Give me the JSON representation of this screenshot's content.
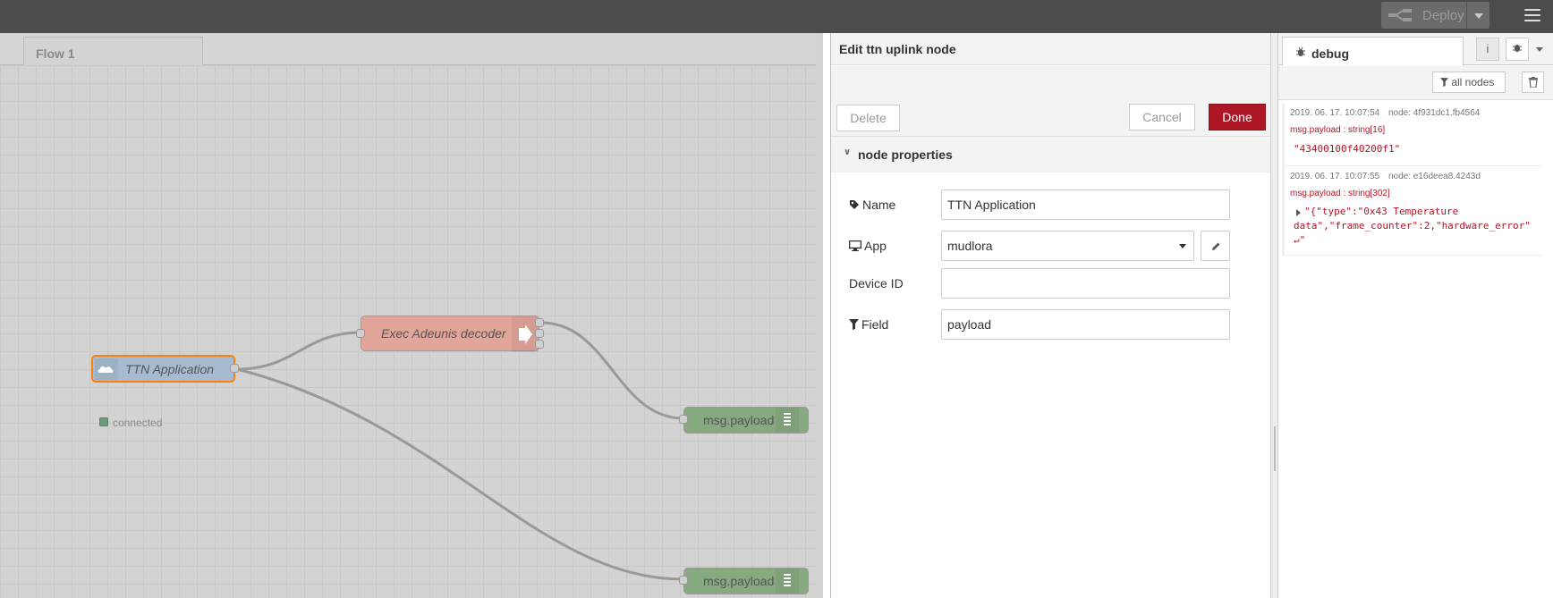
{
  "header": {
    "deploy_label": "Deploy"
  },
  "workspace": {
    "tab_label": "Flow 1",
    "nodes": {
      "ttn": {
        "label": "TTN Application",
        "status": "connected",
        "color": "#a6bbcf",
        "border": "#ff7f0e"
      },
      "decoder": {
        "label": "Exec Adeunis decoder",
        "color": "#e2a59a"
      },
      "debug1": {
        "label": "msg.payload",
        "color": "#87a980"
      },
      "debug2": {
        "label": "msg.payload",
        "color": "#87a980"
      }
    }
  },
  "editor": {
    "title": "Edit ttn uplink node",
    "delete_label": "Delete",
    "cancel_label": "Cancel",
    "done_label": "Done",
    "section_title": "node properties",
    "fields": {
      "name_label": "Name",
      "name_value": "TTN Application",
      "app_label": "App",
      "app_value": "mudlora",
      "device_label": "Device ID",
      "device_value": "",
      "field_label": "Field",
      "field_value": "payload"
    }
  },
  "sidebar": {
    "tab_label": "debug",
    "filter_label": "all nodes",
    "messages": [
      {
        "time": "2019. 06. 17. 10:07:54",
        "node": "node: 4f931dc1.fb4564",
        "topic": "msg.payload : string[16]",
        "value": "\"43400100f40200f1\""
      },
      {
        "time": "2019. 06. 17. 10:07:55",
        "node": "node: e16deea8.4243d",
        "topic": "msg.payload : string[302]",
        "value_line1": "\"{\"type\":\"0x43 Temperature",
        "value_line2": "data\",\"frame_counter\":2,\"hardware_error\"",
        "value_line3": "↵\""
      }
    ]
  },
  "colors": {
    "accent": "#ad1625",
    "header": "#4c4c4c",
    "canvas": "#d3d3d3"
  }
}
